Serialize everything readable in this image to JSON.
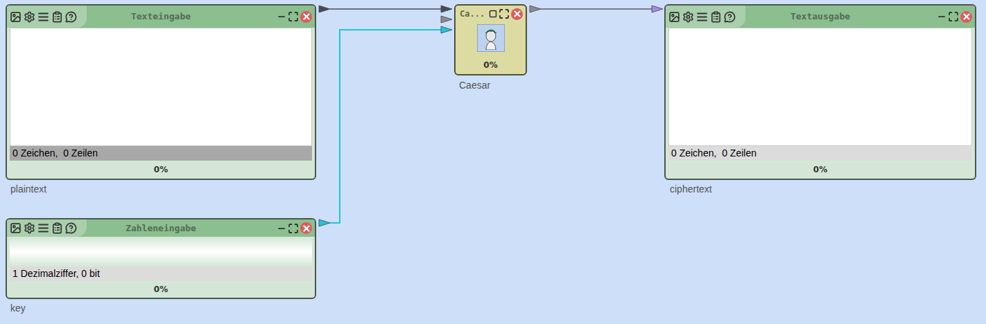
{
  "nodes": [
    {
      "kind": "text-input",
      "title": "Texteingabe",
      "label": "plaintext",
      "content": "",
      "status": "0 Zeichen,  0 Zeilen",
      "status_highlighted": true,
      "progress": "0%",
      "level": 0
    },
    {
      "kind": "number-input",
      "title": "Zahleneingabe",
      "label": "key",
      "content": "",
      "status": "1 Dezimalziffer, 0 bit",
      "status_highlighted": false,
      "progress": "0%",
      "level": 0
    },
    {
      "kind": "plugin",
      "title": "Ca...",
      "label": "Caesar",
      "progress": "0%",
      "level": 0
    },
    {
      "kind": "text-output",
      "title": "Textausgabe",
      "label": "ciphertext",
      "content": "",
      "status": "0 Zeichen,  0 Zeilen",
      "status_highlighted": false,
      "progress": "0%",
      "level": 0
    }
  ],
  "connections": [
    {
      "from": "plaintext",
      "to": "Caesar",
      "color": "#6b6f80",
      "arrow_color": "#4a4a55"
    },
    {
      "from": "key",
      "to": "Caesar",
      "color": "#20c6d8",
      "arrow_color": "#20c6d8"
    },
    {
      "from": "Caesar",
      "to": "ciphertext",
      "color": "#7a7c88",
      "arrow_color": "#a58be6"
    }
  ]
}
